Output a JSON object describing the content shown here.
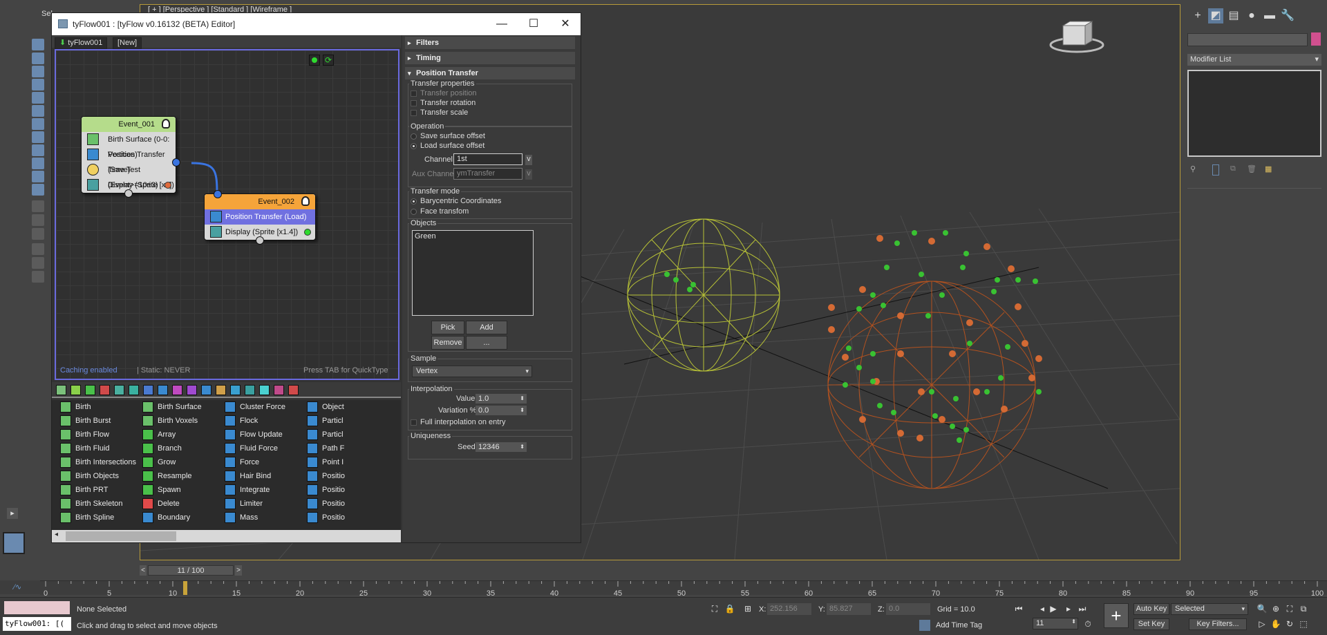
{
  "app": {
    "viewport_label": "[ + ] [Perspective ] [Standard ] [Wireframe ]",
    "left_label": "Sel"
  },
  "tyflow": {
    "title": "tyFlow001 : [tyFlow v0.16132 (BETA) Editor]",
    "flow_tab": "tyFlow001",
    "new_tab": "[New]",
    "events": [
      {
        "name": "Event_001",
        "header_color": "#b5dc8b",
        "ops": [
          {
            "label": "Birth Surface (0-0: Vertices)",
            "icon": "birth-surface-icon"
          },
          {
            "label": "Position Transfer (Save)",
            "icon": "position-transfer-icon"
          },
          {
            "label": "Time Test (Event>=10±3)",
            "icon": "time-test-icon"
          },
          {
            "label": "Display (Sprite [x2])",
            "icon": "display-icon",
            "dot_color": "#e06b3c"
          }
        ]
      },
      {
        "name": "Event_002",
        "header_color": "#f5a43a",
        "ops": [
          {
            "label": "Position Transfer (Load)",
            "icon": "position-transfer-icon",
            "selected": true
          },
          {
            "label": "Display (Sprite [x1.4])",
            "icon": "display-icon",
            "dot_color": "#2fd92f"
          }
        ]
      }
    ],
    "graph_footer": {
      "caching": "Caching enabled",
      "static": "| Static: NEVER",
      "hint": "Press TAB for QuickType"
    },
    "operator_columns": [
      [
        "Birth",
        "Birth Burst",
        "Birth Flow",
        "Birth Fluid",
        "Birth Intersections",
        "Birth Objects",
        "Birth PRT",
        "Birth Skeleton",
        "Birth Spline"
      ],
      [
        "Birth Surface",
        "Birth Voxels",
        "Array",
        "Branch",
        "Grow",
        "Resample",
        "Spawn",
        "Delete",
        "Boundary"
      ],
      [
        "Cluster Force",
        "Flock",
        "Flow Update",
        "Fluid Force",
        "Force",
        "Hair Bind",
        "Integrate",
        "Limiter",
        "Mass"
      ],
      [
        "Object",
        "Particl",
        "Particl",
        "Path F",
        "Point I",
        "Positio",
        "Positio",
        "Positio",
        "Positio"
      ]
    ],
    "props": {
      "rollouts": [
        "Filters",
        "Timing",
        "Position Transfer"
      ],
      "transfer_properties": {
        "label": "Transfer properties",
        "items": [
          {
            "label": "Transfer position",
            "checked": true,
            "disabled": true
          },
          {
            "label": "Transfer rotation",
            "checked": false
          },
          {
            "label": "Transfer scale",
            "checked": false
          }
        ]
      },
      "operation": {
        "label": "Operation",
        "options": [
          "Save surface offset",
          "Load surface offset"
        ],
        "selected": "Load surface offset",
        "channel_label": "Channel:",
        "channel_value": "1st",
        "aux_label": "Aux Channel:",
        "aux_value": "ymTransfer",
        "v": "v"
      },
      "transfer_mode": {
        "label": "Transfer mode",
        "options": [
          "Barycentric Coordinates",
          "Face transfom"
        ],
        "selected": "Barycentric Coordinates"
      },
      "objects": {
        "label": "Objects",
        "list": [
          "Green"
        ],
        "pick": "Pick",
        "add_selected": "Add Selected",
        "remove": "Remove",
        "more": "..."
      },
      "sample": {
        "label": "Sample",
        "value": "Vertex"
      },
      "interpolation": {
        "label": "Interpolation",
        "value_label": "Value:",
        "value": "1.0",
        "variation_label": "Variation %:",
        "variation": "0.0",
        "full_label": "Full interpolation on entry"
      },
      "uniqueness": {
        "label": "Uniqueness",
        "seed_label": "Seed:",
        "seed": "12346"
      }
    }
  },
  "right_panel": {
    "modifier_list": "Modifier List",
    "color_swatch": "#d1508f"
  },
  "timeline": {
    "slider": "11 / 100",
    "ticks": [
      0,
      5,
      10,
      15,
      20,
      25,
      30,
      35,
      40,
      45,
      50,
      55,
      60,
      65,
      70,
      75,
      80,
      85,
      90,
      95,
      100
    ],
    "current_frame": 11
  },
  "status": {
    "maxscript": "tyFlow001: [(",
    "selection": "None Selected",
    "prompt": "Click and drag to select and move objects",
    "x_label": "X:",
    "x_value": "252.156",
    "y_label": "Y:",
    "y_value": "85.827",
    "z_label": "Z:",
    "z_value": "0.0",
    "grid": "Grid = 10.0",
    "add_time_tag": "Add Time Tag",
    "auto_key": "Auto Key",
    "set_key": "Set Key",
    "selected_dropdown": "Selected",
    "frame_field": "11",
    "key_filters": "Key Filters..."
  }
}
